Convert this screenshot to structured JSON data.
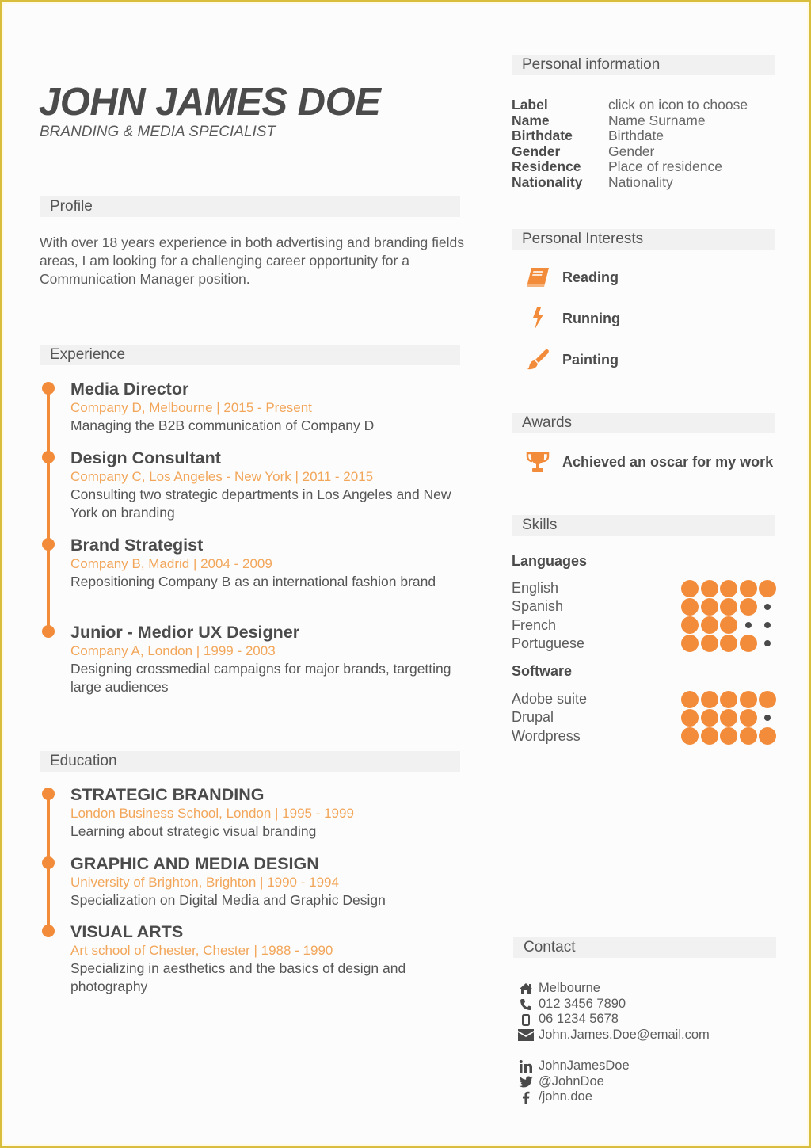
{
  "header": {
    "name": "JOHN JAMES  DOE",
    "title": "BRANDING & MEDIA SPECIALIST"
  },
  "colors": {
    "accent": "#f28c3b",
    "accent_light": "#f2a65a",
    "text": "#4b4b4b",
    "section_bg": "#f1f1f1",
    "border": "#d9bd3c"
  },
  "sections": {
    "profile": "Profile",
    "experience": "Experience",
    "education": "Education",
    "personal_information": "Personal information",
    "personal_interests": "Personal Interests",
    "awards": "Awards",
    "skills": "Skills",
    "contact": "Contact"
  },
  "profile": {
    "text": "With over 18 years experience in both advertising and branding fields areas, I am looking for a challenging career opportunity for a Communication Manager position."
  },
  "experience": [
    {
      "title": "Media Director",
      "sub": "Company D, Melbourne | 2015 - Present",
      "desc": "Managing the B2B communication of Company D"
    },
    {
      "title": "Design Consultant",
      "sub": "Company C, Los Angeles - New York | 2011 - 2015",
      "desc": "Consulting two strategic departments in Los Angeles and New York on branding"
    },
    {
      "title": "Brand Strategist",
      "sub": "Company B, Madrid | 2004 - 2009",
      "desc": "Repositioning Company B as an international fashion brand"
    },
    {
      "title": "Junior - Medior UX Designer",
      "sub": "Company A, London | 1999 - 2003",
      "desc": "Designing crossmedial campaigns for major brands, targetting large audiences"
    }
  ],
  "education": [
    {
      "title": "STRATEGIC BRANDING",
      "sub": "London Business School, London | 1995 - 1999",
      "desc": "Learning about strategic visual branding"
    },
    {
      "title": "GRAPHIC AND MEDIA DESIGN",
      "sub": "University of Brighton, Brighton | 1990 - 1994",
      "desc": "Specialization on Digital Media and Graphic Design"
    },
    {
      "title": "VISUAL ARTS",
      "sub": "Art school of Chester, Chester | 1988 - 1990",
      "desc": "Specializing in aesthetics and the basics of design and photography"
    }
  ],
  "personal_information": [
    {
      "key": "Label",
      "value": "click on icon to choose"
    },
    {
      "key": "Name",
      "value": "Name Surname"
    },
    {
      "key": "Birthdate",
      "value": "Birthdate"
    },
    {
      "key": "Gender",
      "value": "Gender"
    },
    {
      "key": "Residence",
      "value": "Place of residence"
    },
    {
      "key": "Nationality",
      "value": "Nationality"
    }
  ],
  "interests": [
    {
      "label": "Reading",
      "icon": "book-icon"
    },
    {
      "label": "Running",
      "icon": "lightning-icon"
    },
    {
      "label": "Painting",
      "icon": "paintbrush-icon"
    }
  ],
  "awards": [
    {
      "label": "Achieved an oscar for my work",
      "icon": "trophy-icon"
    }
  ],
  "skills": {
    "languages_label": "Languages",
    "software_label": "Software",
    "max_level": 5,
    "languages": [
      {
        "name": "English",
        "level": 5
      },
      {
        "name": "Spanish",
        "level": 4
      },
      {
        "name": "French",
        "level": 3
      },
      {
        "name": "Portuguese",
        "level": 4
      }
    ],
    "software": [
      {
        "name": "Adobe suite",
        "level": 5
      },
      {
        "name": "Drupal",
        "level": 4
      },
      {
        "name": "Wordpress",
        "level": 5
      }
    ]
  },
  "contact": {
    "details": [
      {
        "icon": "home-icon",
        "value": "Melbourne"
      },
      {
        "icon": "phone-icon",
        "value": "012 3456 7890"
      },
      {
        "icon": "mobile-icon",
        "value": "06 1234 5678"
      },
      {
        "icon": "email-icon",
        "value": "John.James.Doe@email.com"
      }
    ],
    "social": [
      {
        "icon": "linkedin-icon",
        "value": "JohnJamesDoe"
      },
      {
        "icon": "twitter-icon",
        "value": "@JohnDoe"
      },
      {
        "icon": "facebook-icon",
        "value": "/john.doe"
      }
    ]
  }
}
